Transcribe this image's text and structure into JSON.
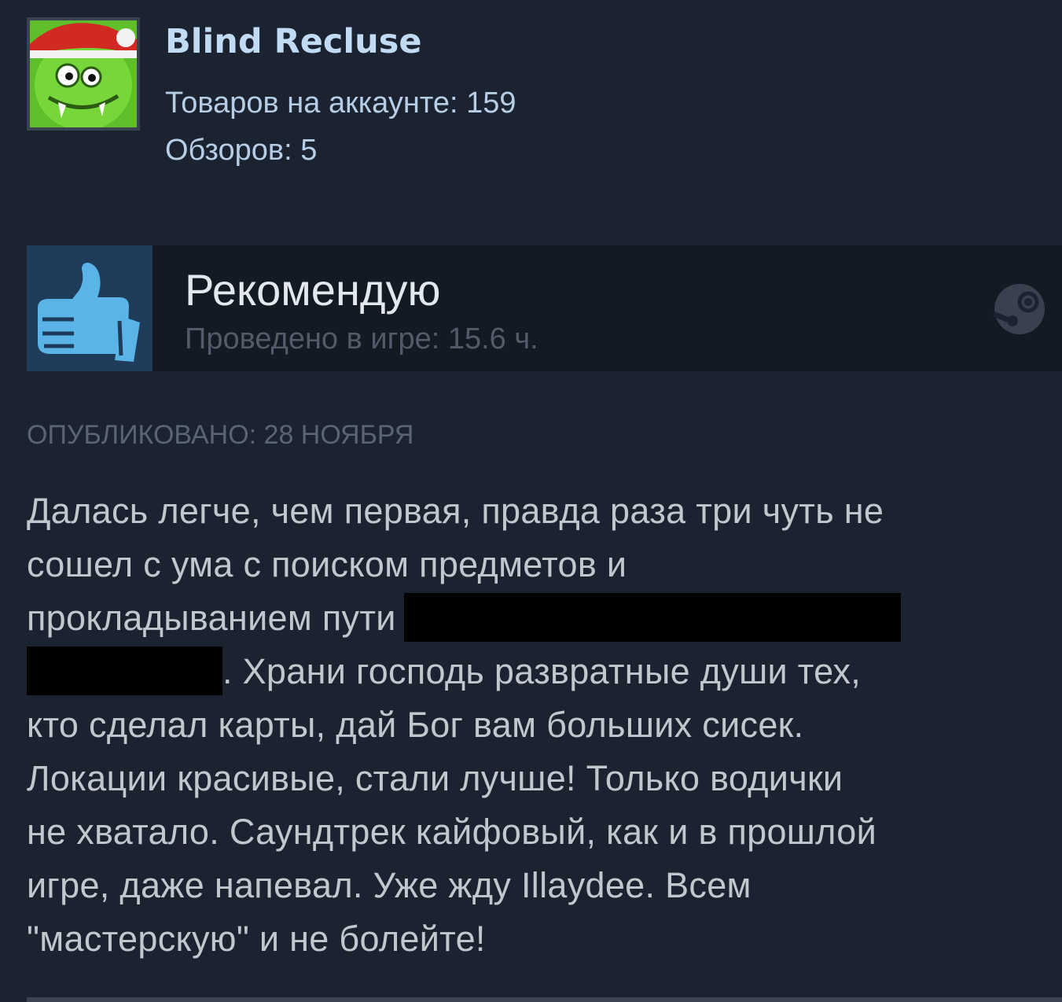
{
  "author": {
    "name": "Blind Recluse",
    "products_label": "Товаров на аккаунте: 159",
    "reviews_label": "Обзоров: 5",
    "avatar": "green-goblin-santa-hat-avatar"
  },
  "verdict": {
    "title": "Рекомендую",
    "playtime": "Проведено в игре: 15.6 ч.",
    "thumb_icon": "thumbs-up-icon",
    "platform_icon": "steam-icon"
  },
  "review": {
    "published": "ОПУБЛИКОВАНО: 28 НОЯБРЯ",
    "lines": [
      "Далась легче, чем первая, правда раза три чуть не",
      "сошел с ума с поиском предметов и",
      "прокладыванием пути",
      ". Храни господь развратные души тех,",
      "кто сделал карты, дай Бог вам больших сисек.",
      "Локации красивые, стали лучше! Только водички",
      "не хватало. Саундтрек кайфовый, как и в прошлой",
      "игре, даже напевал. Уже жду Illaydee. Всем",
      "\"мастерскую\" и не болейте!"
    ]
  },
  "colors": {
    "background": "#1b2230",
    "author_name": "#c1dbf4",
    "verdict_bar": "#141a24",
    "thumb_box": "#1f3c5a",
    "thumb": "#5ab4e8",
    "redaction": "#000000"
  }
}
